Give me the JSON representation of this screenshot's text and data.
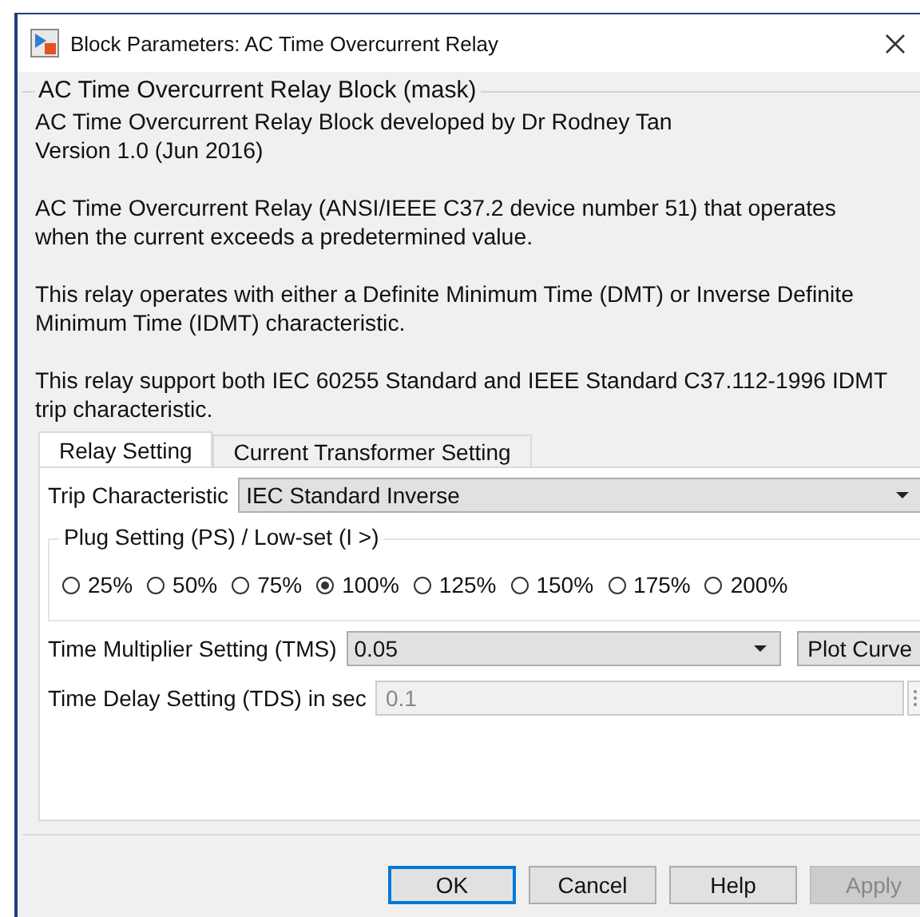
{
  "window": {
    "title": "Block Parameters: AC Time Overcurrent Relay"
  },
  "mask_group": {
    "title": "AC Time Overcurrent Relay Block (mask)",
    "paragraphs": [
      {
        "lines": [
          "AC Time Overcurrent Relay Block developed by Dr Rodney Tan",
          "Version 1.0 (Jun 2016)"
        ]
      },
      {
        "lines": [
          "AC Time Overcurrent Relay (ANSI/IEEE C37.2 device number 51) that operates",
          "when the current exceeds a predetermined value."
        ]
      },
      {
        "lines": [
          "This relay operates with either a Definite Minimum Time (DMT) or Inverse Definite",
          "Minimum Time (IDMT) characteristic."
        ]
      },
      {
        "lines": [
          "This relay support both IEC 60255 Standard and IEEE Standard C37.112-1996 IDMT",
          "trip characteristic."
        ]
      }
    ]
  },
  "tabs": [
    {
      "label": "Relay Setting",
      "selected": true
    },
    {
      "label": "Current Transformer Setting",
      "selected": false
    }
  ],
  "parameters": [
    {
      "kind": "dropdown",
      "label": "Trip Characteristic",
      "value": "IEC Standard Inverse"
    },
    {
      "kind": "radio_group",
      "label": "Plug Setting (PS) / Low-set (I >)",
      "options": [
        {
          "label": "25%",
          "selected": false
        },
        {
          "label": "50%",
          "selected": false
        },
        {
          "label": "75%",
          "selected": false
        },
        {
          "label": "100%",
          "selected": true
        },
        {
          "label": "125%",
          "selected": false
        },
        {
          "label": "150%",
          "selected": false
        },
        {
          "label": "175%",
          "selected": false
        },
        {
          "label": "200%",
          "selected": false
        }
      ]
    },
    {
      "kind": "dropdown_button",
      "label": "Time Multiplier Setting (TMS)",
      "value": "0.05",
      "button": "Plot Curve"
    },
    {
      "kind": "text",
      "label": "Time Delay Setting (TDS) in sec",
      "value": "0.1",
      "disabled": true
    }
  ],
  "buttons": [
    {
      "label": "OK",
      "kind": "default"
    },
    {
      "label": "Cancel",
      "kind": "normal"
    },
    {
      "label": "Help",
      "kind": "normal"
    },
    {
      "label": "Apply",
      "kind": "disabled"
    }
  ]
}
